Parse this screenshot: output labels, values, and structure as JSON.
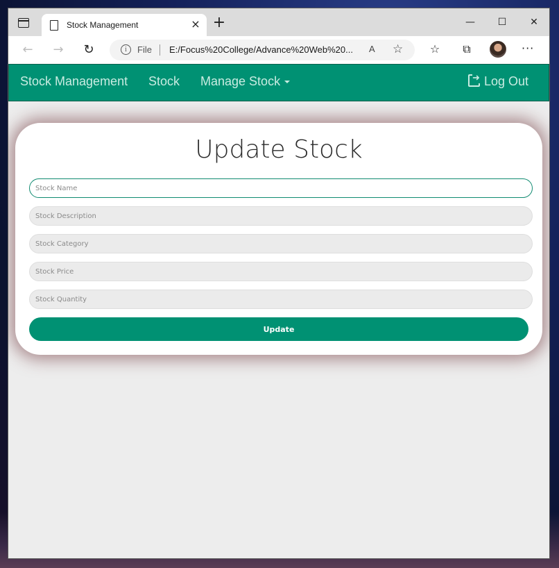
{
  "browser": {
    "tab_title": "Stock Management",
    "tab_close": "×",
    "new_tab": "+",
    "minimize": "—",
    "maximize": "☐",
    "close": "✕",
    "back": "←",
    "forward": "→",
    "reload": "↻",
    "info_glyph": "i",
    "url_scheme_label": "File",
    "url": "E:/Focus%20College/Advance%20Web%20...",
    "read_aloud": "A",
    "add_favorite": "☆",
    "favorites": "☆",
    "collections": "⧉",
    "more": "···"
  },
  "navbar": {
    "brand": "Stock Management",
    "links": [
      "Stock",
      "Manage Stock"
    ],
    "logout": "Log Out"
  },
  "form": {
    "title": "Update Stock",
    "fields": [
      {
        "placeholder": "Stock Name",
        "value": ""
      },
      {
        "placeholder": "Stock Description",
        "value": ""
      },
      {
        "placeholder": "Stock Category",
        "value": ""
      },
      {
        "placeholder": "Stock Price",
        "value": ""
      },
      {
        "placeholder": "Stock Quantity",
        "value": ""
      }
    ],
    "submit_label": "Update"
  },
  "colors": {
    "primary": "#009173",
    "nav_text": "#c9ece2",
    "page_bg": "#ededed"
  }
}
